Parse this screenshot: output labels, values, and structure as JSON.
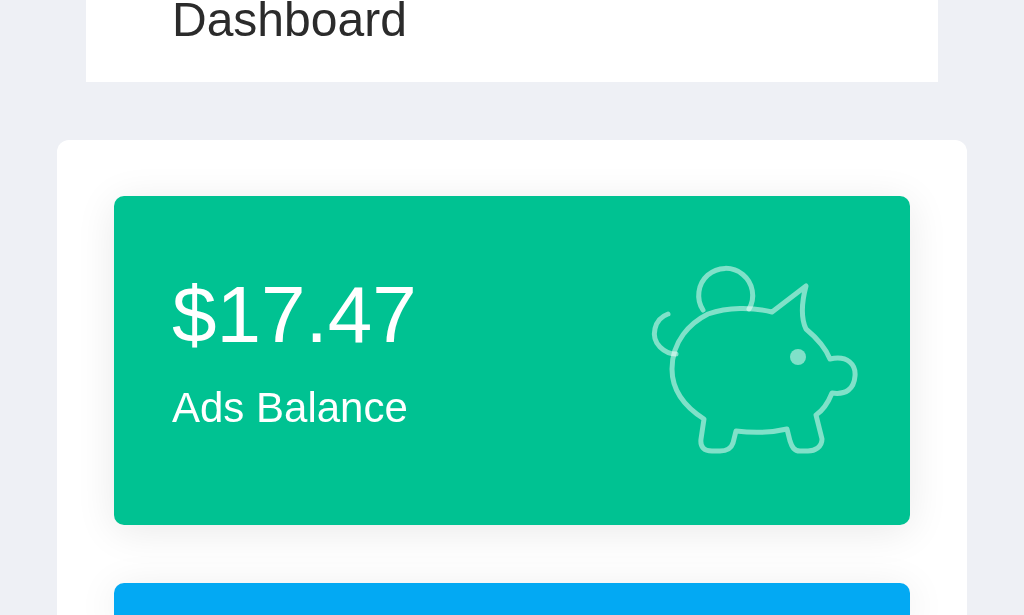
{
  "header": {
    "title": "Dashboard"
  },
  "cards": [
    {
      "value": "$17.47",
      "label": "Ads Balance",
      "color": "#00c292"
    },
    {
      "color": "#03a9f3"
    }
  ]
}
